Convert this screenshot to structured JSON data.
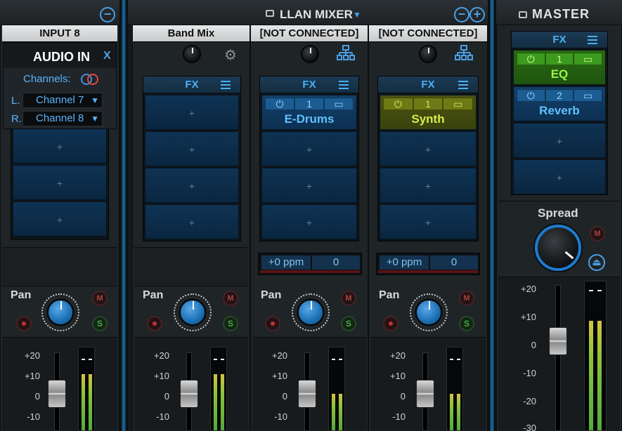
{
  "top": {
    "mixer_title": "LLAN MIXER",
    "master_title": "MASTER"
  },
  "input_channel": {
    "title": "INPUT 8",
    "audio_in": {
      "title": "AUDIO IN",
      "close": "X",
      "channels_label": "Channels:",
      "left_label": "L.",
      "left_value": "Channel 7",
      "right_label": "R.",
      "right_value": "Channel 8"
    },
    "pan_label": "Pan",
    "scale": [
      "+20",
      "+10",
      "0",
      "-10"
    ]
  },
  "strips": [
    {
      "title": "Band Mix",
      "fx_label": "FX",
      "plugin": null,
      "pan_label": "Pan",
      "scale": [
        "+20",
        "+10",
        "0",
        "-10"
      ]
    },
    {
      "title": "[NOT CONNECTED]",
      "fx_label": "FX",
      "plugin": {
        "index": "1",
        "name": "E-Drums",
        "color": "blue"
      },
      "ppm": "+0 ppm",
      "ppm_value": "0",
      "pan_label": "Pan",
      "scale": [
        "+20",
        "+10",
        "0",
        "-10"
      ]
    },
    {
      "title": "[NOT CONNECTED]",
      "fx_label": "FX",
      "plugin": {
        "index": "1",
        "name": "Synth",
        "color": "olive"
      },
      "ppm": "+0 ppm",
      "ppm_value": "0",
      "pan_label": "Pan",
      "scale": [
        "+20",
        "+10",
        "0",
        "-10"
      ]
    }
  ],
  "master": {
    "fx_label": "FX",
    "plugins": [
      {
        "index": "1",
        "name": "EQ",
        "color": "green"
      },
      {
        "index": "2",
        "name": "Reverb",
        "color": "blue"
      }
    ],
    "spread_label": "Spread",
    "scale": [
      "+20",
      "+10",
      "0",
      "-10",
      "-20",
      "-30"
    ]
  },
  "buttons": {
    "mute": "M",
    "solo": "S"
  },
  "colors": {
    "accent": "#4ab0f5",
    "meter_green": "#56a83c",
    "meter_yellow": "#d4c243"
  }
}
